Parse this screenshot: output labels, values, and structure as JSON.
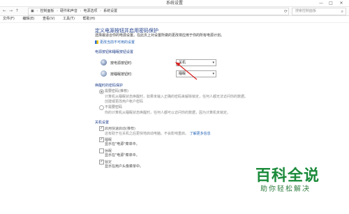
{
  "window": {
    "title": "系统设置",
    "min": "—",
    "max": "□",
    "close": "✕"
  },
  "address": {
    "crumbs": [
      "控制面板",
      "硬件和声音",
      "电源选项",
      "系统设置"
    ],
    "search_placeholder": "搜索控制面板"
  },
  "menu": [
    "文件(F)",
    "编辑(E)",
    "查看(V)",
    "工具(T)",
    "帮助(H)"
  ],
  "page": {
    "title": "定义电源按钮并启用密码保护",
    "desc": "选择最适合你的电源设置。在此页上对设置所做的更改将应用于你的所有电源计划。",
    "change_link": "更改当前不可用的设置",
    "section_power": "电源按钮和睡眠按钮设置",
    "power_label": "按电源按钮时:",
    "power_value": "关机",
    "sleep_label": "按睡眠按钮时:",
    "sleep_value": "睡眠",
    "section_wake": "唤醒时的密码保护",
    "radio1_label": "需要密码(推荐)",
    "radio1_sub1": "计算机从睡眠状态唤醒时，如果未输入正确的密码来解除锁定，任何人都无法访问你的数据。",
    "radio1_link": "创建或更改用户帐户密码",
    "radio2_label": "不需要密码",
    "radio2_sub": "你的计算机从睡眠状态唤醒时，任何人都可以访问你的数据，因为计算机未锁定。",
    "section_shutdown": "关机设置",
    "cb1_label": "启用快速启动(推荐)",
    "cb1_sub": "这有助于在关机之后更快地启动电脑。不会影响重启。",
    "cb1_link": "了解更多信息",
    "cb2_label": "睡眠",
    "cb2_sub": "显示在\"电源\"菜单中。",
    "cb3_label": "休眠",
    "cb3_sub": "显示在\"电源\"菜单中。",
    "cb4_label": "锁定",
    "cb4_sub": "显示在用户头像菜单中。"
  },
  "watermark": {
    "main": "百科全说",
    "sub": "助你轻松解决"
  },
  "colors": {
    "arrow": "#d81e1e",
    "title": "#1e3e8a",
    "link": "#1f5fb5",
    "watermark": "#1a8a3a"
  }
}
